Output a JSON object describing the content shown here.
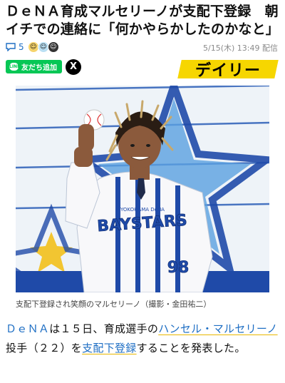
{
  "article": {
    "headline": "ＤｅＮＡ育成マルセリーノが支配下登録　朝イチでの連絡に「何かやらかしたのかなと」",
    "comment_count": "5",
    "date": "5/15(木) 13:49 配信",
    "line_button_label": "友だち追加",
    "line_badge": "LINE",
    "x_button_label": "X",
    "publisher_logo": "デイリー",
    "photo_caption": "支配下登録され笑顔のマルセリーノ（撮影・金田祐二）",
    "body": {
      "team": "ＤｅＮＡ",
      "text1": "は１５日、育成選手の",
      "player_link": "ハンセル・マルセリーノ",
      "text2": "投手（２２）を",
      "registration_link": "支配下登録",
      "text3": "することを発表した。"
    }
  },
  "photo": {
    "jersey_text": "BAYSTARS",
    "jersey_brand": "YOKOHAMA DeNA",
    "jersey_number": "98",
    "colors": {
      "team_blue": "#1f4aa8",
      "sky_blue": "#5aa0e0",
      "star_yellow": "#f2c531"
    }
  },
  "colors": {
    "link_blue": "#1f6fc4",
    "line_green": "#06c755",
    "logo_yellow": "#f6d600"
  }
}
